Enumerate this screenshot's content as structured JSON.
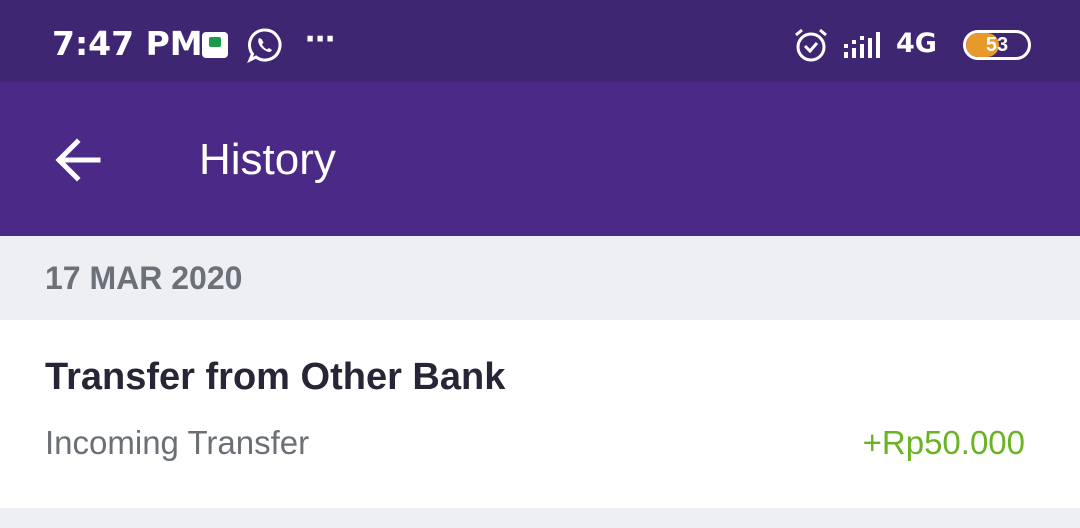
{
  "status_bar": {
    "time": "7:47 PM",
    "notification_icons": [
      "bank-app-icon",
      "whatsapp-icon"
    ],
    "more": "⋯",
    "network": "4G",
    "battery_level": "53",
    "battery_fraction": 0.53,
    "battery_color": "#e79a2a"
  },
  "app_bar": {
    "back_icon": "arrow-left-icon",
    "title": "History",
    "background": "#4b2a87"
  },
  "history": {
    "groups": [
      {
        "date": "17 MAR 2020",
        "items": [
          {
            "title": "Transfer from Other Bank",
            "subtitle": "Incoming Transfer",
            "amount": "+Rp50.000",
            "amount_color": "#6ab423"
          }
        ]
      }
    ]
  }
}
